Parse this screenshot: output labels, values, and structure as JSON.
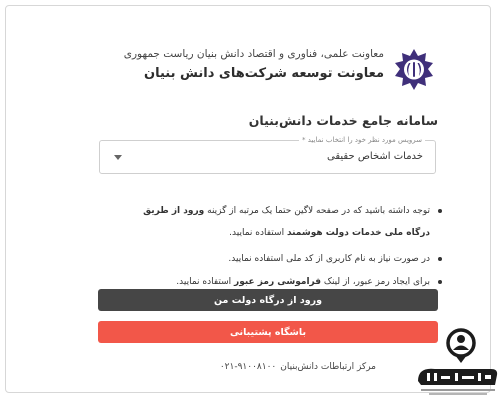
{
  "header": {
    "org_line1": "معاونت علمی، فناوری و اقتصاد دانش بنیان ریاست جمهوری",
    "org_line2": "معاونت توسعه شرکت‌های دانش بنیان"
  },
  "system_title": "سامانه جامع خدمات دانش‌بنیان",
  "service_select": {
    "label": "سرویس مورد نظر خود را انتخاب نمایید *",
    "value": "خدمات اشخاص حقیقی"
  },
  "notes": {
    "note1": {
      "part1": "توجه داشته باشید که در صفحه لاگین حتما یک مرتبه از گزینه ",
      "bold1": "ورود از طریق",
      "bold2": "درگاه ملی خدمات دولت هوشمند",
      "part2": " استفاده نمایید."
    },
    "note2": "در صورت نیاز به نام کاربری از کد ملی استفاده نمایید.",
    "note3": {
      "part1": "برای ایجاد رمز عبور، از لینک ",
      "bold": "فراموشی رمز عبور",
      "part2": " استفاده نمایید."
    }
  },
  "buttons": {
    "login": "ورود از درگاه دولت من",
    "support": "باشگاه پشتیبانی"
  },
  "contact": {
    "label": "مرکز ارتباطات دانش‌بنیان",
    "phone": "۰۲۱-۹۱۰۰۸۱۰۰"
  },
  "watermark": {
    "wordmark": "بازار استخدام",
    "tagline": "رسانه تخصصی استخدام و بازار کار ایران"
  },
  "colors": {
    "emblem": "#3f2f7a",
    "login_button": "#464646",
    "support_button": "#f25749",
    "watermark": "#1c1c1c"
  },
  "icons": {
    "emblem": "iran-emblem-icon",
    "select_arrow": "chevron-down-icon",
    "watermark": "person-location-icon"
  }
}
